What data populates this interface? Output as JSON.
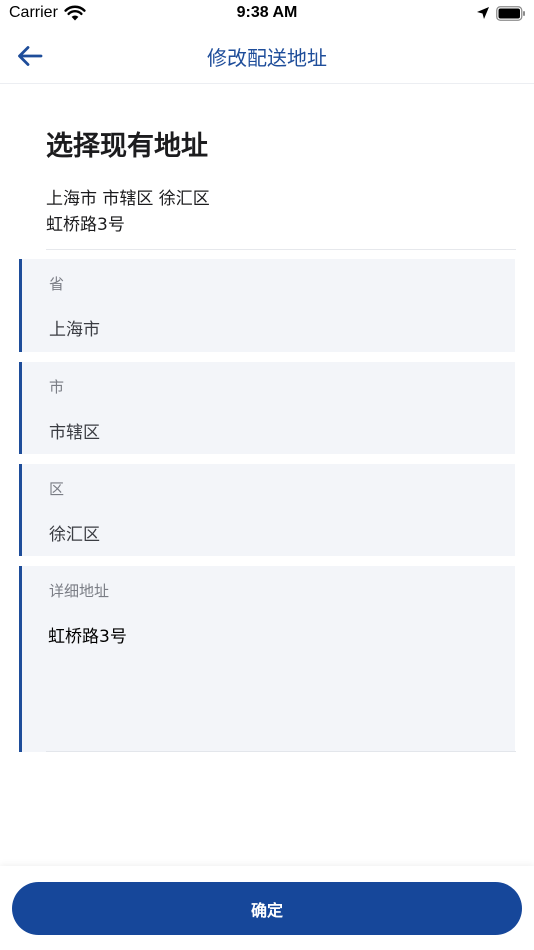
{
  "status_bar": {
    "carrier": "Carrier",
    "time": "9:38 AM",
    "icons": [
      "wifi-icon",
      "location-arrow-icon",
      "battery-icon"
    ]
  },
  "nav": {
    "title": "修改配送地址",
    "back_icon": "arrow-left-icon"
  },
  "section": {
    "title": "选择现有地址",
    "current_address_line1": "上海市 市辖区 徐汇区",
    "current_address_line2": "虹桥路3号"
  },
  "fields": {
    "province": {
      "label": "省",
      "value": "上海市"
    },
    "city": {
      "label": "市",
      "value": "市辖区"
    },
    "district": {
      "label": "区",
      "value": "徐汇区"
    },
    "detail": {
      "label": "详细地址",
      "value": "虹桥路3号"
    }
  },
  "confirm_label": "确定",
  "colors": {
    "primary": "#16479a",
    "nav_title": "#1e4d9a",
    "field_bg": "#f3f5f9",
    "field_border": "#1e4d9a"
  }
}
